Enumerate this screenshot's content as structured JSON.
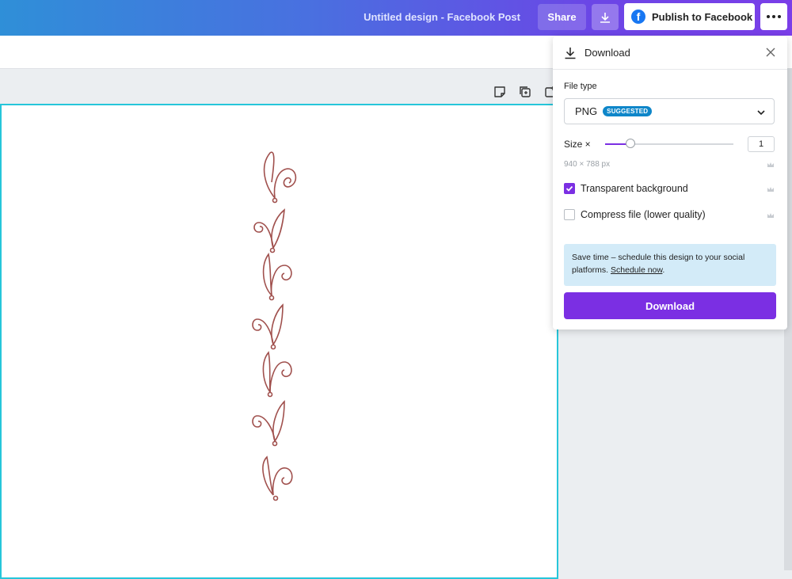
{
  "header": {
    "document_title": "Untitled design - Facebook Post",
    "share_label": "Share",
    "download_icon": "download-icon",
    "publish_label": "Publish to Facebook",
    "more_icon": "more-dots-icon"
  },
  "page_tools": [
    "note-icon",
    "duplicate-page-icon",
    "add-page-icon"
  ],
  "download_panel": {
    "title": "Download",
    "file_type_label": "File type",
    "file_type_value": "PNG",
    "suggested_badge": "SUGGESTED",
    "size_label": "Size ×",
    "size_value": "1",
    "size_slider_fraction": 0.2,
    "dimensions": "940 × 788 px",
    "transparent_label": "Transparent background",
    "transparent_checked": true,
    "compress_label": "Compress file (lower quality)",
    "compress_checked": false,
    "info_text": "Save time – schedule this design to your social platforms. ",
    "info_link": "Schedule now",
    "info_end": ".",
    "download_button": "Download"
  },
  "colors": {
    "accent": "#7b2fe3",
    "canvas_border": "#26c6da",
    "swirl": "#a0504d",
    "info_bg": "#d3ebf8"
  }
}
